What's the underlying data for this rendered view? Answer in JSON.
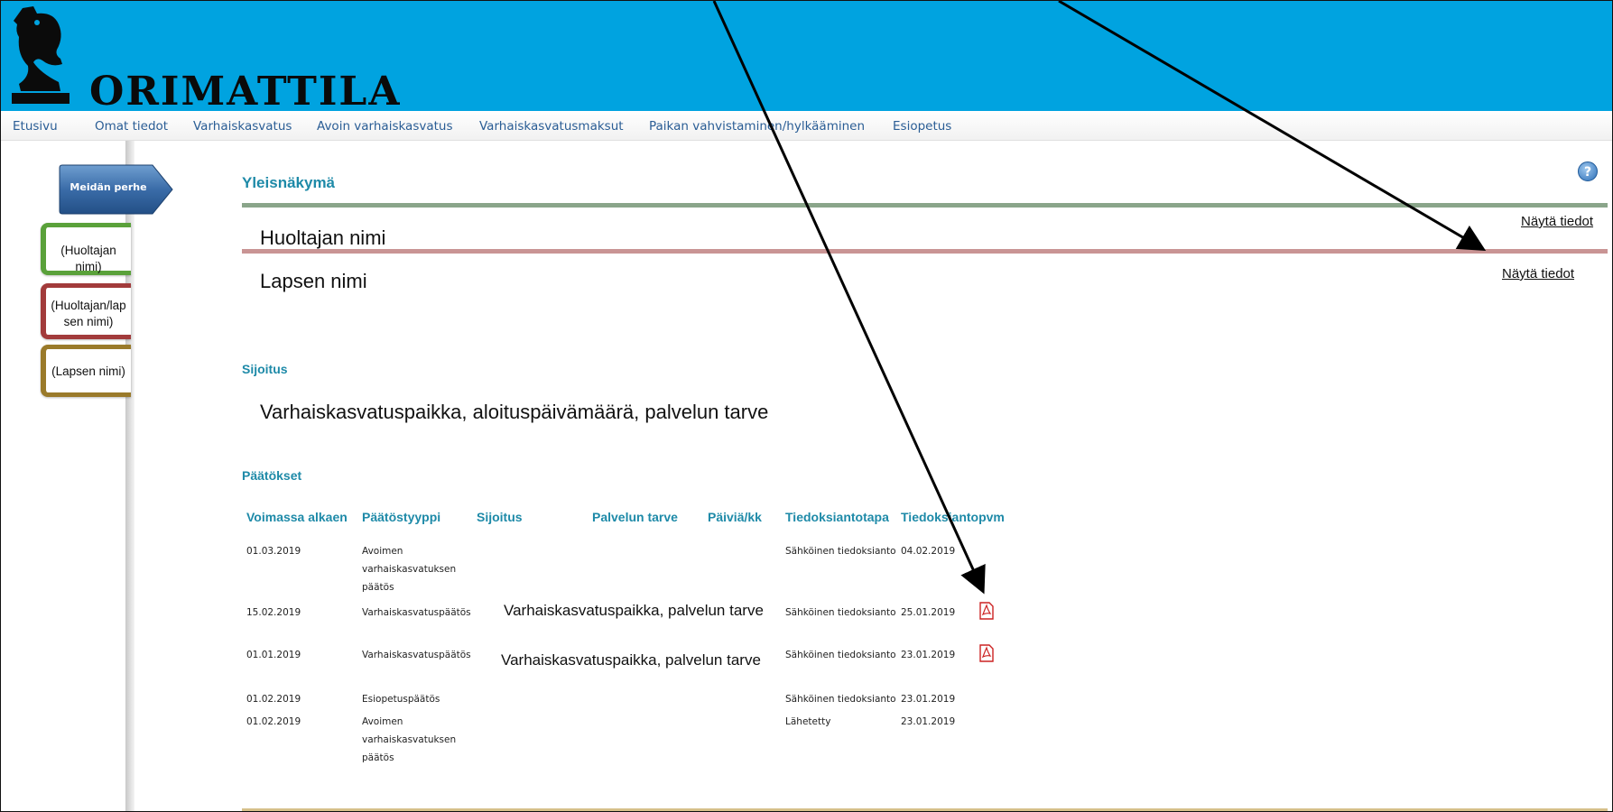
{
  "header": {
    "logo_text": "ORIMATTILA"
  },
  "nav": {
    "items": [
      "Etusivu",
      "Omat tiedot",
      "Varhaiskasvatus",
      "Avoin varhaiskasvatus",
      "Varhaiskasvatusmaksut",
      "Paikan vahvistaminen/hylkääminen",
      "Esiopetus"
    ]
  },
  "sidebar": {
    "family_tab": "Meidän perhe",
    "tabs": [
      {
        "label": "(Huoltajan nimi)",
        "color": "#5aa13a"
      },
      {
        "label": "(Huoltajan/lapsen nimi)",
        "line1": "(Huoltajan/lap",
        "line2": "sen nimi)",
        "color": "#a23b3b"
      },
      {
        "label": "(Lapsen nimi)",
        "color": "#9a7a2a"
      }
    ]
  },
  "overview": {
    "title": "Yleisnäkymä",
    "guardian_name": "Huoltajan nimi",
    "child_name": "Lapsen nimi",
    "show_details_1": "Näytä tiedot",
    "show_details_2": "Näytä tiedot"
  },
  "placement": {
    "title": "Sijoitus",
    "summary": "Varhaiskasvatuspaikka, aloituspäivämäärä, palvelun tarve"
  },
  "decisions": {
    "title": "Päätökset",
    "columns": [
      "Voimassa alkaen",
      "Päätöstyyppi",
      "Sijoitus",
      "Palvelun tarve",
      "Päiviä/kk",
      "Tiedoksiantotapa",
      "Tiedoksiantopvm"
    ],
    "rows": [
      {
        "start": "01.03.2019",
        "type_l1": "Avoimen",
        "type_l2": "varhaiskasvatuksen",
        "type_l3": "päätös",
        "type": "Avoimen varhaiskasvatuksen päätös",
        "placement": "",
        "method": "Sähköinen tiedoksianto",
        "date": "04.02.2019"
      },
      {
        "start": "15.02.2019",
        "type": "Varhaiskasvatuspäätös",
        "placement": "Varhaiskasvatuspaikka, palvelun tarve",
        "method": "Sähköinen tiedoksianto",
        "date": "25.01.2019"
      },
      {
        "start": "01.01.2019",
        "type": "Varhaiskasvatuspäätös",
        "placement": "Varhaiskasvatuspaikka, palvelun tarve",
        "method": "Sähköinen tiedoksianto",
        "date": "23.01.2019"
      },
      {
        "start": "01.02.2019",
        "type": "Esiopetuspäätös",
        "placement": "",
        "method": "Sähköinen tiedoksianto",
        "date": "23.01.2019"
      },
      {
        "start": "01.02.2019",
        "type_l1": "Avoimen",
        "type_l2": "varhaiskasvatuksen",
        "type_l3": "päätös",
        "type": "Avoimen varhaiskasvatuksen päätös",
        "placement": "",
        "method": "Lähetetty",
        "date": "23.01.2019"
      }
    ]
  },
  "colors": {
    "banner": "#00a3e0",
    "nav_link": "#2a5d95",
    "section_title": "#1e8aa8",
    "line_green": "#8aa58a",
    "line_red": "#c99494",
    "line_gold": "#d6c08a"
  },
  "icons": [
    "knight-logo-icon",
    "help-icon",
    "pdf-icon"
  ]
}
